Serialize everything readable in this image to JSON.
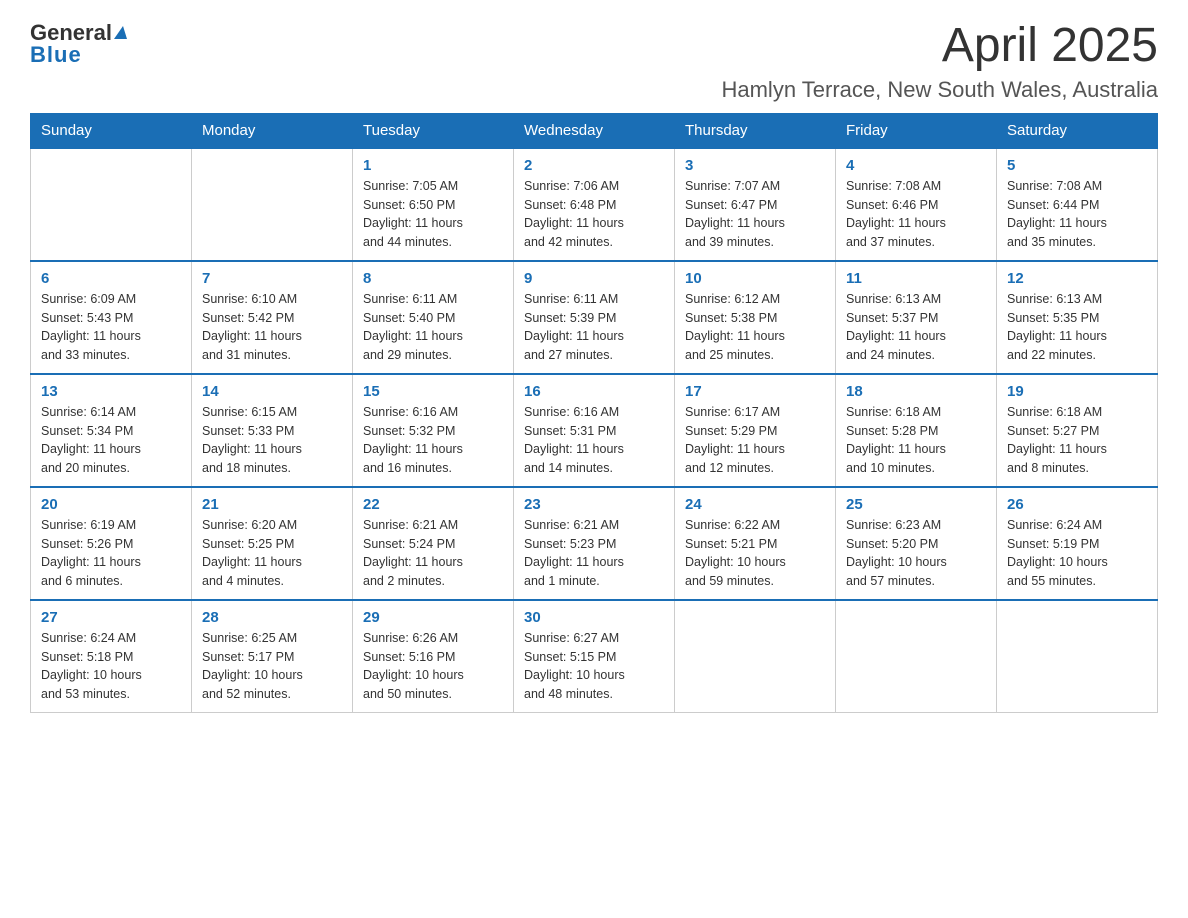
{
  "header": {
    "logo": {
      "general": "General",
      "arrow_symbol": "▶",
      "blue": "Blue"
    },
    "title": "April 2025",
    "location": "Hamlyn Terrace, New South Wales, Australia"
  },
  "calendar": {
    "days_of_week": [
      "Sunday",
      "Monday",
      "Tuesday",
      "Wednesday",
      "Thursday",
      "Friday",
      "Saturday"
    ],
    "weeks": [
      [
        {
          "day": "",
          "info": ""
        },
        {
          "day": "",
          "info": ""
        },
        {
          "day": "1",
          "info": "Sunrise: 7:05 AM\nSunset: 6:50 PM\nDaylight: 11 hours\nand 44 minutes."
        },
        {
          "day": "2",
          "info": "Sunrise: 7:06 AM\nSunset: 6:48 PM\nDaylight: 11 hours\nand 42 minutes."
        },
        {
          "day": "3",
          "info": "Sunrise: 7:07 AM\nSunset: 6:47 PM\nDaylight: 11 hours\nand 39 minutes."
        },
        {
          "day": "4",
          "info": "Sunrise: 7:08 AM\nSunset: 6:46 PM\nDaylight: 11 hours\nand 37 minutes."
        },
        {
          "day": "5",
          "info": "Sunrise: 7:08 AM\nSunset: 6:44 PM\nDaylight: 11 hours\nand 35 minutes."
        }
      ],
      [
        {
          "day": "6",
          "info": "Sunrise: 6:09 AM\nSunset: 5:43 PM\nDaylight: 11 hours\nand 33 minutes."
        },
        {
          "day": "7",
          "info": "Sunrise: 6:10 AM\nSunset: 5:42 PM\nDaylight: 11 hours\nand 31 minutes."
        },
        {
          "day": "8",
          "info": "Sunrise: 6:11 AM\nSunset: 5:40 PM\nDaylight: 11 hours\nand 29 minutes."
        },
        {
          "day": "9",
          "info": "Sunrise: 6:11 AM\nSunset: 5:39 PM\nDaylight: 11 hours\nand 27 minutes."
        },
        {
          "day": "10",
          "info": "Sunrise: 6:12 AM\nSunset: 5:38 PM\nDaylight: 11 hours\nand 25 minutes."
        },
        {
          "day": "11",
          "info": "Sunrise: 6:13 AM\nSunset: 5:37 PM\nDaylight: 11 hours\nand 24 minutes."
        },
        {
          "day": "12",
          "info": "Sunrise: 6:13 AM\nSunset: 5:35 PM\nDaylight: 11 hours\nand 22 minutes."
        }
      ],
      [
        {
          "day": "13",
          "info": "Sunrise: 6:14 AM\nSunset: 5:34 PM\nDaylight: 11 hours\nand 20 minutes."
        },
        {
          "day": "14",
          "info": "Sunrise: 6:15 AM\nSunset: 5:33 PM\nDaylight: 11 hours\nand 18 minutes."
        },
        {
          "day": "15",
          "info": "Sunrise: 6:16 AM\nSunset: 5:32 PM\nDaylight: 11 hours\nand 16 minutes."
        },
        {
          "day": "16",
          "info": "Sunrise: 6:16 AM\nSunset: 5:31 PM\nDaylight: 11 hours\nand 14 minutes."
        },
        {
          "day": "17",
          "info": "Sunrise: 6:17 AM\nSunset: 5:29 PM\nDaylight: 11 hours\nand 12 minutes."
        },
        {
          "day": "18",
          "info": "Sunrise: 6:18 AM\nSunset: 5:28 PM\nDaylight: 11 hours\nand 10 minutes."
        },
        {
          "day": "19",
          "info": "Sunrise: 6:18 AM\nSunset: 5:27 PM\nDaylight: 11 hours\nand 8 minutes."
        }
      ],
      [
        {
          "day": "20",
          "info": "Sunrise: 6:19 AM\nSunset: 5:26 PM\nDaylight: 11 hours\nand 6 minutes."
        },
        {
          "day": "21",
          "info": "Sunrise: 6:20 AM\nSunset: 5:25 PM\nDaylight: 11 hours\nand 4 minutes."
        },
        {
          "day": "22",
          "info": "Sunrise: 6:21 AM\nSunset: 5:24 PM\nDaylight: 11 hours\nand 2 minutes."
        },
        {
          "day": "23",
          "info": "Sunrise: 6:21 AM\nSunset: 5:23 PM\nDaylight: 11 hours\nand 1 minute."
        },
        {
          "day": "24",
          "info": "Sunrise: 6:22 AM\nSunset: 5:21 PM\nDaylight: 10 hours\nand 59 minutes."
        },
        {
          "day": "25",
          "info": "Sunrise: 6:23 AM\nSunset: 5:20 PM\nDaylight: 10 hours\nand 57 minutes."
        },
        {
          "day": "26",
          "info": "Sunrise: 6:24 AM\nSunset: 5:19 PM\nDaylight: 10 hours\nand 55 minutes."
        }
      ],
      [
        {
          "day": "27",
          "info": "Sunrise: 6:24 AM\nSunset: 5:18 PM\nDaylight: 10 hours\nand 53 minutes."
        },
        {
          "day": "28",
          "info": "Sunrise: 6:25 AM\nSunset: 5:17 PM\nDaylight: 10 hours\nand 52 minutes."
        },
        {
          "day": "29",
          "info": "Sunrise: 6:26 AM\nSunset: 5:16 PM\nDaylight: 10 hours\nand 50 minutes."
        },
        {
          "day": "30",
          "info": "Sunrise: 6:27 AM\nSunset: 5:15 PM\nDaylight: 10 hours\nand 48 minutes."
        },
        {
          "day": "",
          "info": ""
        },
        {
          "day": "",
          "info": ""
        },
        {
          "day": "",
          "info": ""
        }
      ]
    ]
  }
}
